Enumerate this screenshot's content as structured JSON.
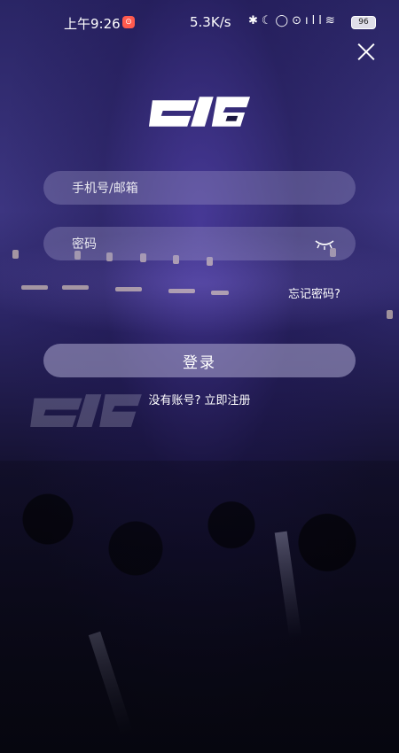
{
  "status_bar": {
    "time": "上午9:26",
    "app_badge": "⊙",
    "network_speed": "5.3K/s",
    "icons": "✱☾◯⊙ıll≋",
    "battery": "96"
  },
  "close_icon": "close-icon",
  "form": {
    "account_placeholder": "手机号/邮箱",
    "password_placeholder": "密码",
    "forgot_label": "忘记密码?",
    "login_label": "登录",
    "no_account_label": "没有账号?",
    "register_label": "立即注册"
  },
  "colors": {
    "accent_field": "#a09bc8",
    "button": "#afaad2",
    "background_top": "#3c3580",
    "background_bottom": "#0a0918"
  }
}
